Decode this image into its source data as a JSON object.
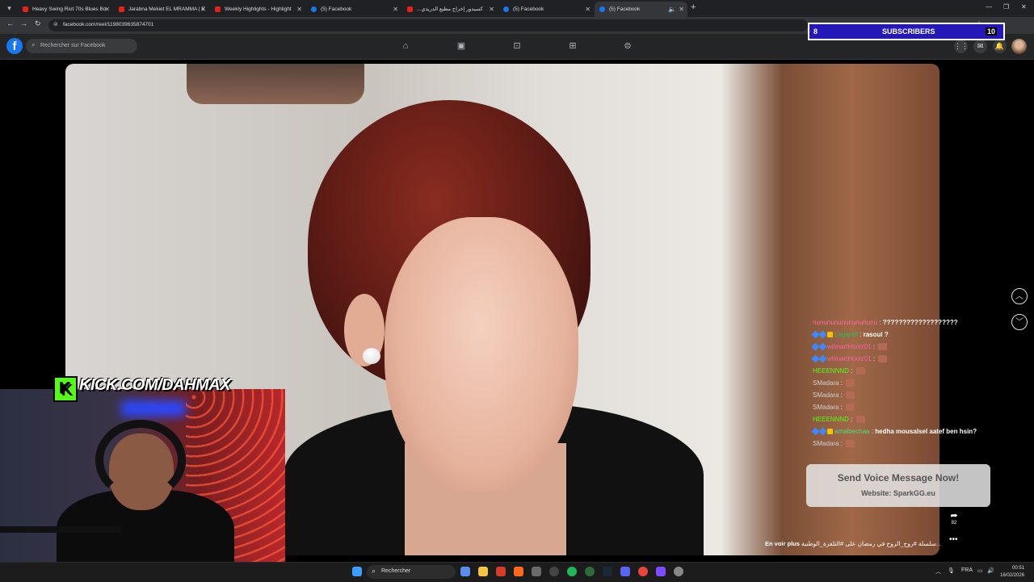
{
  "browser": {
    "tabs": [
      {
        "label": "Heavy Swing Riot 70s Blues Bo",
        "type": "yt"
      },
      {
        "label": "Jarabna Mekiet EL MRAMMA | E",
        "type": "yt"
      },
      {
        "label": "Weekly Highlights - Highlight",
        "type": "yt"
      },
      {
        "label": "(5) Facebook",
        "type": "fb"
      },
      {
        "label": "...كسيدور إخراج مطيع الدريدي",
        "type": "yt"
      },
      {
        "label": "(5) Facebook",
        "type": "fb"
      },
      {
        "label": "(5) Facebook",
        "type": "fb"
      }
    ],
    "url": "facebook.com/reel/1198039635874701"
  },
  "facebook": {
    "search_placeholder": "Rechercher sur Facebook",
    "logo_letter": "f",
    "messenger_badge": "2"
  },
  "overlay": {
    "subs_count": "8",
    "subs_label": "SUBSCRIBERS",
    "subs_goal": "10",
    "kick_text": "KICK.COM/DAHMAX",
    "kick_icon": "K"
  },
  "chat": [
    {
      "user": "nununununununununu",
      "text": "???????????????????",
      "badges": 0,
      "emote": false,
      "color": "u1"
    },
    {
      "user": "Loganbf",
      "text": "rasoul ?",
      "badges": 3,
      "emote": false,
      "color": "u2"
    },
    {
      "user": "wilmartHoolz01",
      "text": "",
      "badges": 2,
      "emote": true,
      "color": "u3"
    },
    {
      "user": "wilmartHoolz01",
      "text": "",
      "badges": 2,
      "emote": true,
      "color": "u3"
    },
    {
      "user": "HEEENNND",
      "text": "",
      "badges": 0,
      "emote": true,
      "color": "u4"
    },
    {
      "user": "SMadara",
      "text": "",
      "badges": 0,
      "emote": true,
      "color": "u5"
    },
    {
      "user": "SMadara",
      "text": "",
      "badges": 0,
      "emote": true,
      "color": "u5"
    },
    {
      "user": "SMadara",
      "text": "",
      "badges": 0,
      "emote": true,
      "color": "u5"
    },
    {
      "user": "HEEENNND",
      "text": "",
      "badges": 0,
      "emote": true,
      "color": "u4"
    },
    {
      "user": "amalbechaa",
      "text": "hedha mousalsel aatef ben hsin?",
      "badges": 3,
      "emote": false,
      "color": "u6"
    },
    {
      "user": "SMadara",
      "text": "",
      "badges": 0,
      "emote": true,
      "color": "u5"
    }
  ],
  "voice": {
    "title": "Send Voice Message Now!",
    "site": "Website: SparkGG.eu"
  },
  "reel": {
    "caption_text": "سلسلة #روح_الروح في رمضان على #التلفزة_الوطنية...",
    "see_more": "En voir plus",
    "share_count": "82"
  },
  "taskbar": {
    "search_label": "Rechercher",
    "lang": "FRA",
    "time": "00:51",
    "date": "16/02/2026"
  }
}
